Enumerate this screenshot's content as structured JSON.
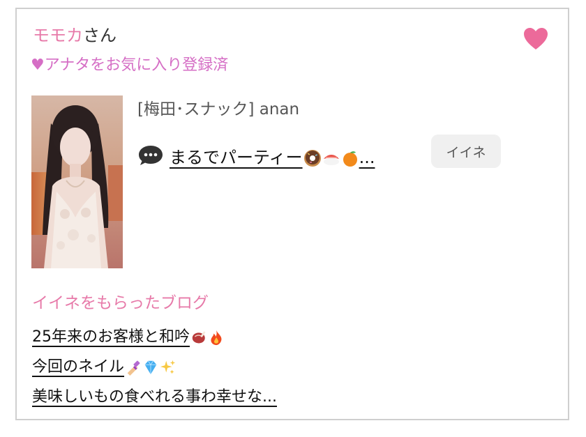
{
  "profile": {
    "name": "モモカ",
    "honorific": "さん",
    "favorite_status": "♥アナタをお気に入り登録済",
    "favorite_icon": "heart-icon",
    "favorite_color": "#ec6a9a"
  },
  "shop": {
    "label": "[梅田･スナック]  anan"
  },
  "latest_blog": {
    "icon": "speech-bubble-icon",
    "title": "まるでパーティー",
    "emojis": [
      "donut-emoji",
      "sushi-emoji",
      "orange-emoji"
    ],
    "ellipsis": "...",
    "like_button": "イイネ"
  },
  "liked_blogs": {
    "heading": "イイネをもらったブログ",
    "items": [
      {
        "text": "25年来のお客様と和吟",
        "emojis": [
          "steak-emoji",
          "fire-emoji"
        ]
      },
      {
        "text": "今回のネイル",
        "emojis": [
          "nail-polish-emoji",
          "gem-emoji",
          "sparkles-emoji"
        ]
      },
      {
        "text": "美味しいもの食べれる事わ幸せな...",
        "emojis": []
      }
    ]
  },
  "colors": {
    "accent_pink": "#e77aa9",
    "status_purple": "#d56ec5",
    "border": "#cfcfcf",
    "button_bg": "#f0f0f0"
  }
}
